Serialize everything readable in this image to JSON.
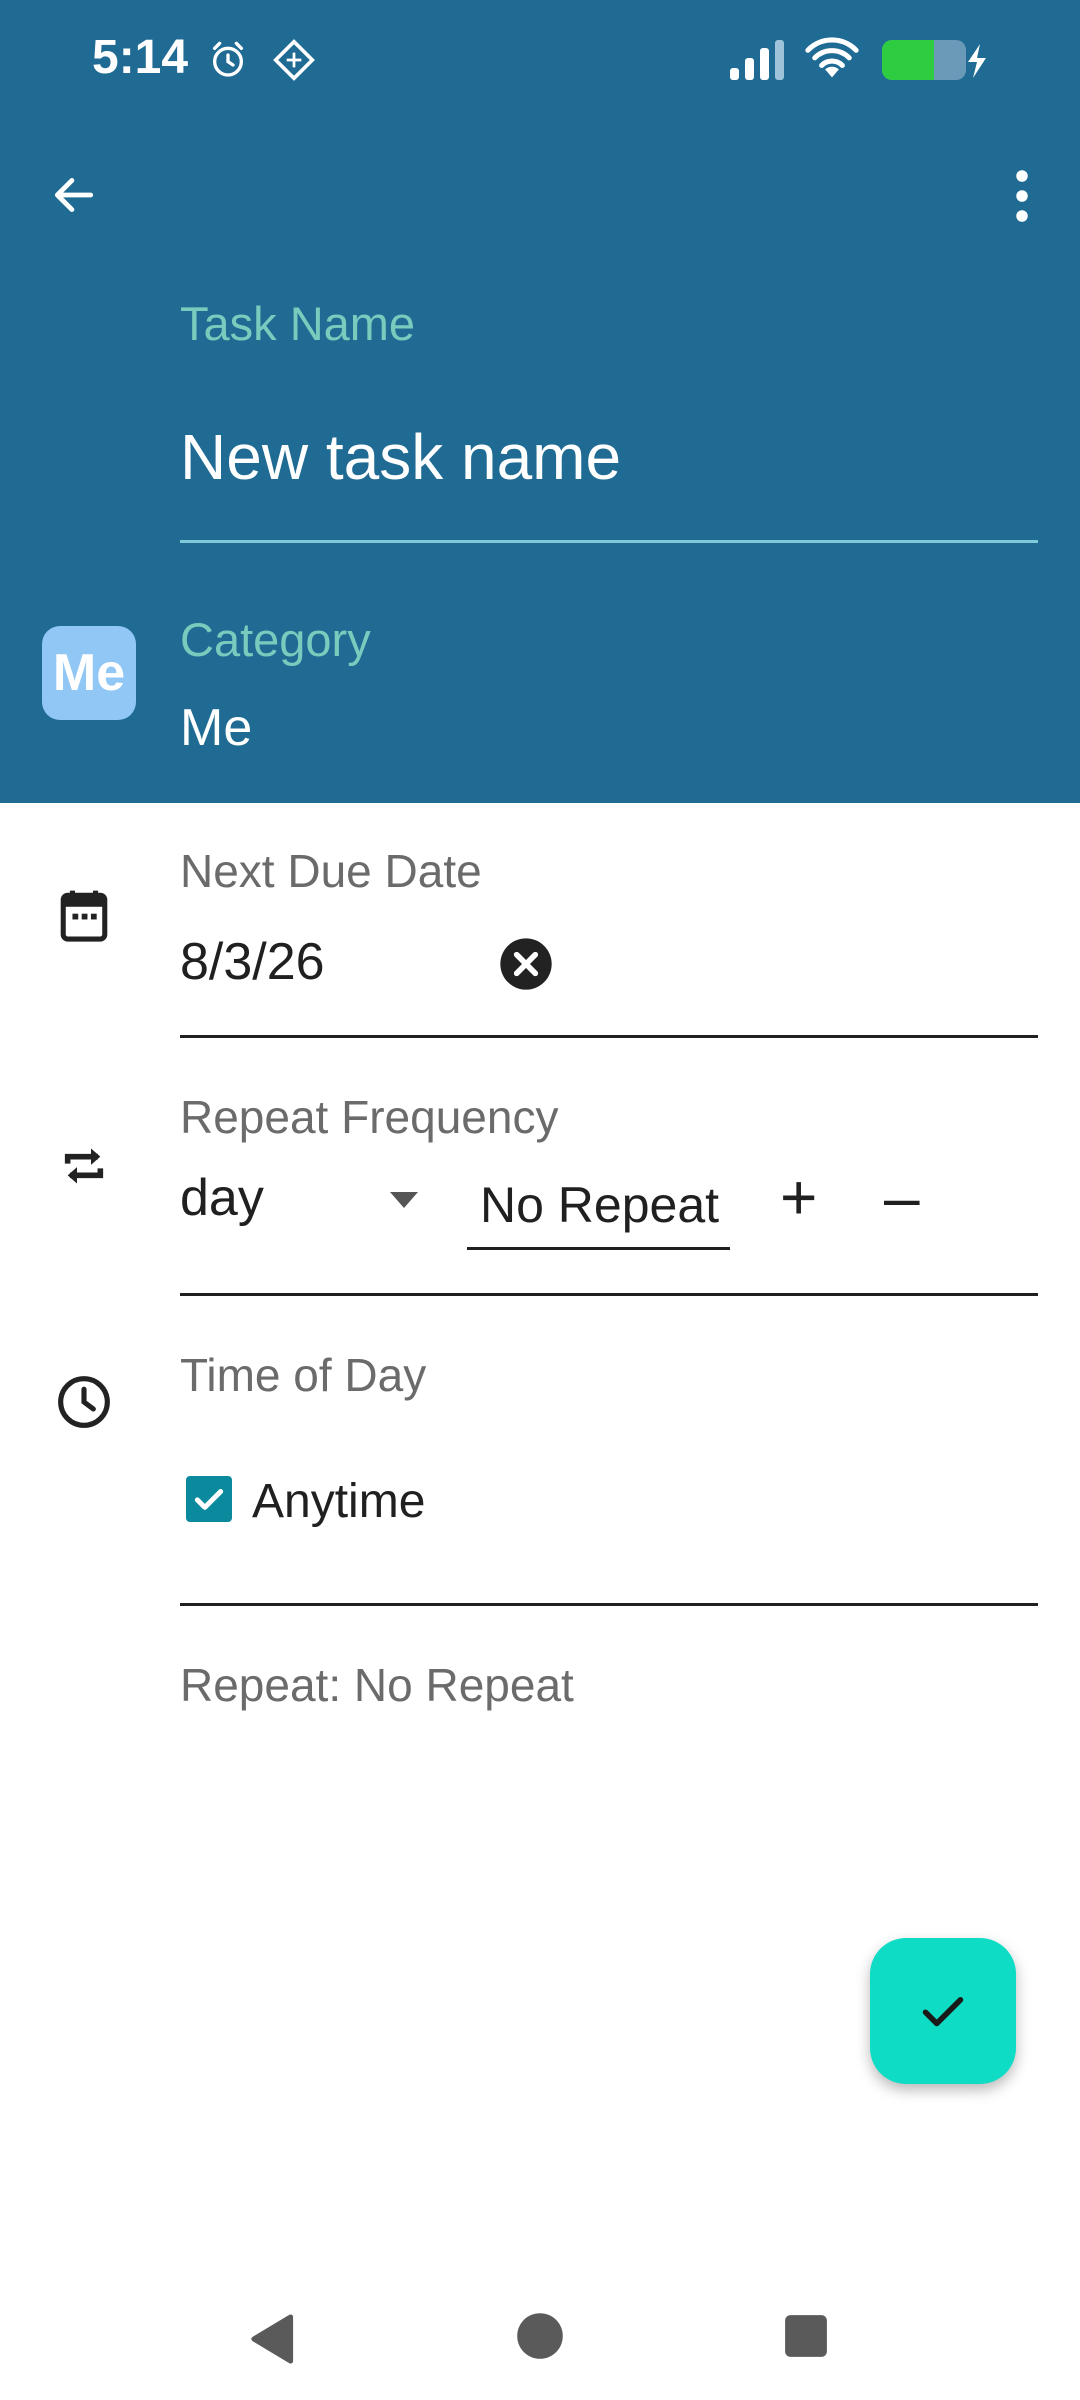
{
  "status_bar": {
    "time": "5:14",
    "icons": [
      "alarm-icon",
      "app-notification-icon",
      "signal-icon",
      "wifi-icon",
      "battery-charging-icon"
    ]
  },
  "toolbar": {
    "back_icon": "arrow-left-icon",
    "menu_icon": "more-vert-icon"
  },
  "task": {
    "label": "Task Name",
    "value": "New task name"
  },
  "category": {
    "badge": "Me",
    "label": "Category",
    "value": "Me"
  },
  "due_date": {
    "label": "Next Due Date",
    "value": "8/3/26"
  },
  "repeat": {
    "label": "Repeat Frequency",
    "unit": "day",
    "amount": "No Repeat",
    "plus": "+",
    "minus": "–"
  },
  "time_of_day": {
    "label": "Time of Day",
    "option": "Anytime",
    "checked": true
  },
  "summary": "Repeat: No Repeat",
  "colors": {
    "header": "#1f6b93",
    "accent_label": "#79cbbd",
    "fab": "#0fdcc4",
    "checkbox": "#0b8a9e"
  }
}
